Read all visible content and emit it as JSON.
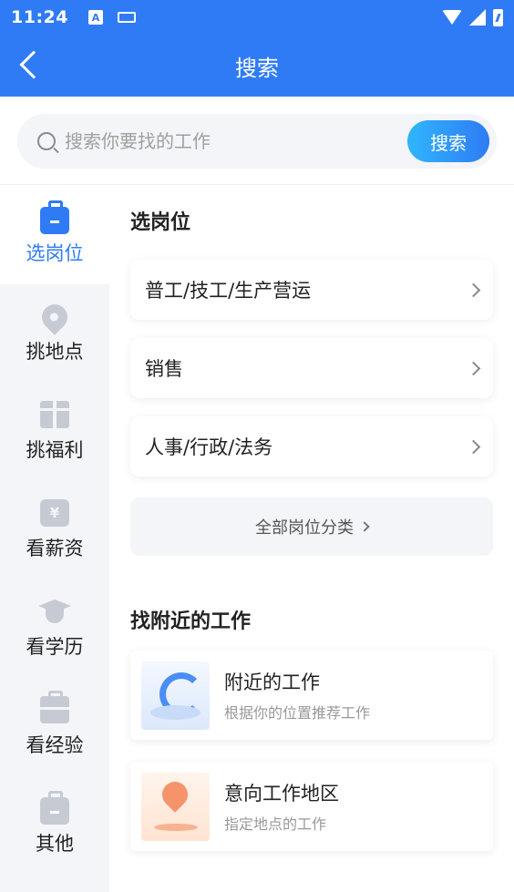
{
  "status_bar": {
    "time": "11:24",
    "a_badge": "A"
  },
  "header": {
    "title": "搜索"
  },
  "search": {
    "placeholder": "搜索你要找的工作",
    "button_label": "搜索"
  },
  "sidebar": {
    "items": [
      {
        "label": "选岗位",
        "icon": "briefcase-icon",
        "active": true
      },
      {
        "label": "挑地点",
        "icon": "location-pin-icon"
      },
      {
        "label": "挑福利",
        "icon": "gift-icon"
      },
      {
        "label": "看薪资",
        "icon": "money-icon",
        "glyph": "¥"
      },
      {
        "label": "看学历",
        "icon": "graduation-cap-icon"
      },
      {
        "label": "看经验",
        "icon": "toolbox-icon"
      },
      {
        "label": "其他",
        "icon": "briefcase-icon"
      }
    ]
  },
  "main": {
    "section1_title": "选岗位",
    "categories": [
      {
        "label": "普工/技工/生产营运"
      },
      {
        "label": "销售"
      },
      {
        "label": "人事/行政/法务"
      }
    ],
    "all_categories_label": "全部岗位分类",
    "section2_title": "找附近的工作",
    "nearby_cards": [
      {
        "title": "附近的工作",
        "subtitle": "根据你的位置推荐工作"
      },
      {
        "title": "意向工作地区",
        "subtitle": "指定地点的工作"
      }
    ]
  },
  "colors": {
    "primary": "#2f7bf5",
    "sidebar_bg": "#f4f5f8",
    "icon_gray": "#c6cbd3"
  }
}
